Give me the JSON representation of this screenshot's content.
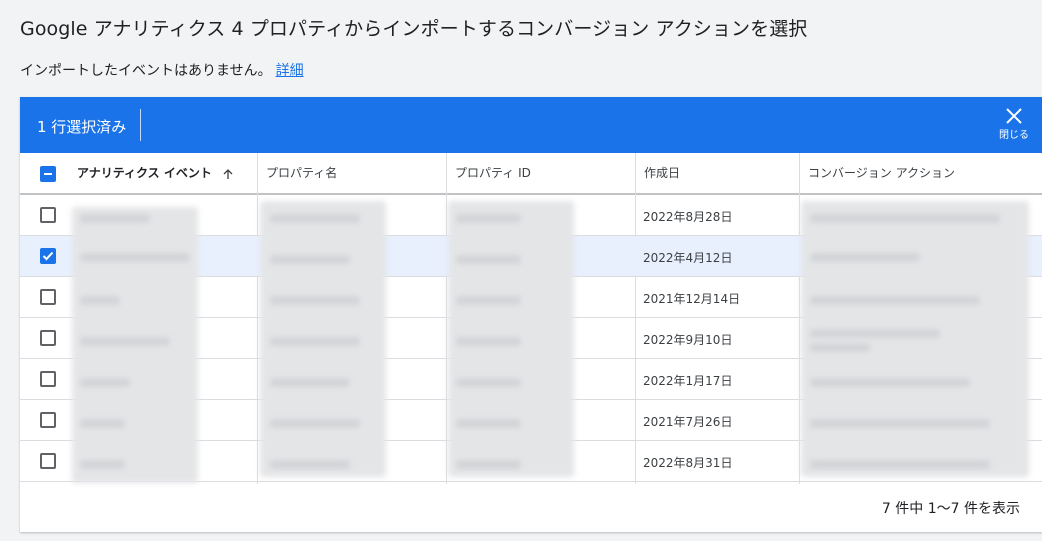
{
  "page": {
    "title": "Google アナリティクス 4 プロパティからインポートするコンバージョン アクションを選択",
    "subtitle": "インポートしたイベントはありません。",
    "details_link": "詳細"
  },
  "selection_bar": {
    "count_label": "1 行選択済み",
    "close_label": "閉じる",
    "close_icon": "close-icon"
  },
  "table": {
    "columns": [
      {
        "label": "アナリティクス イベント",
        "sort": "ascending",
        "icon": "arrow-up-icon"
      },
      {
        "label": "プロパティ名"
      },
      {
        "label": "プロパティ ID"
      },
      {
        "label": "作成日"
      },
      {
        "label": "コンバージョン アクション"
      }
    ],
    "rows": [
      {
        "checked": false,
        "created": "2022年8月28日"
      },
      {
        "checked": true,
        "created": "2022年4月12日"
      },
      {
        "checked": false,
        "created": "2021年12月14日"
      },
      {
        "checked": false,
        "created": "2022年9月10日"
      },
      {
        "checked": false,
        "created": "2022年1月17日"
      },
      {
        "checked": false,
        "created": "2021年7月26日"
      },
      {
        "checked": false,
        "created": "2022年8月31日"
      }
    ]
  },
  "pagination": {
    "label": "7 件中 1〜7 件を表示"
  },
  "colors": {
    "accent": "#1a73e8",
    "selected_row": "#e8f0fe",
    "background": "#f1f3f4"
  }
}
